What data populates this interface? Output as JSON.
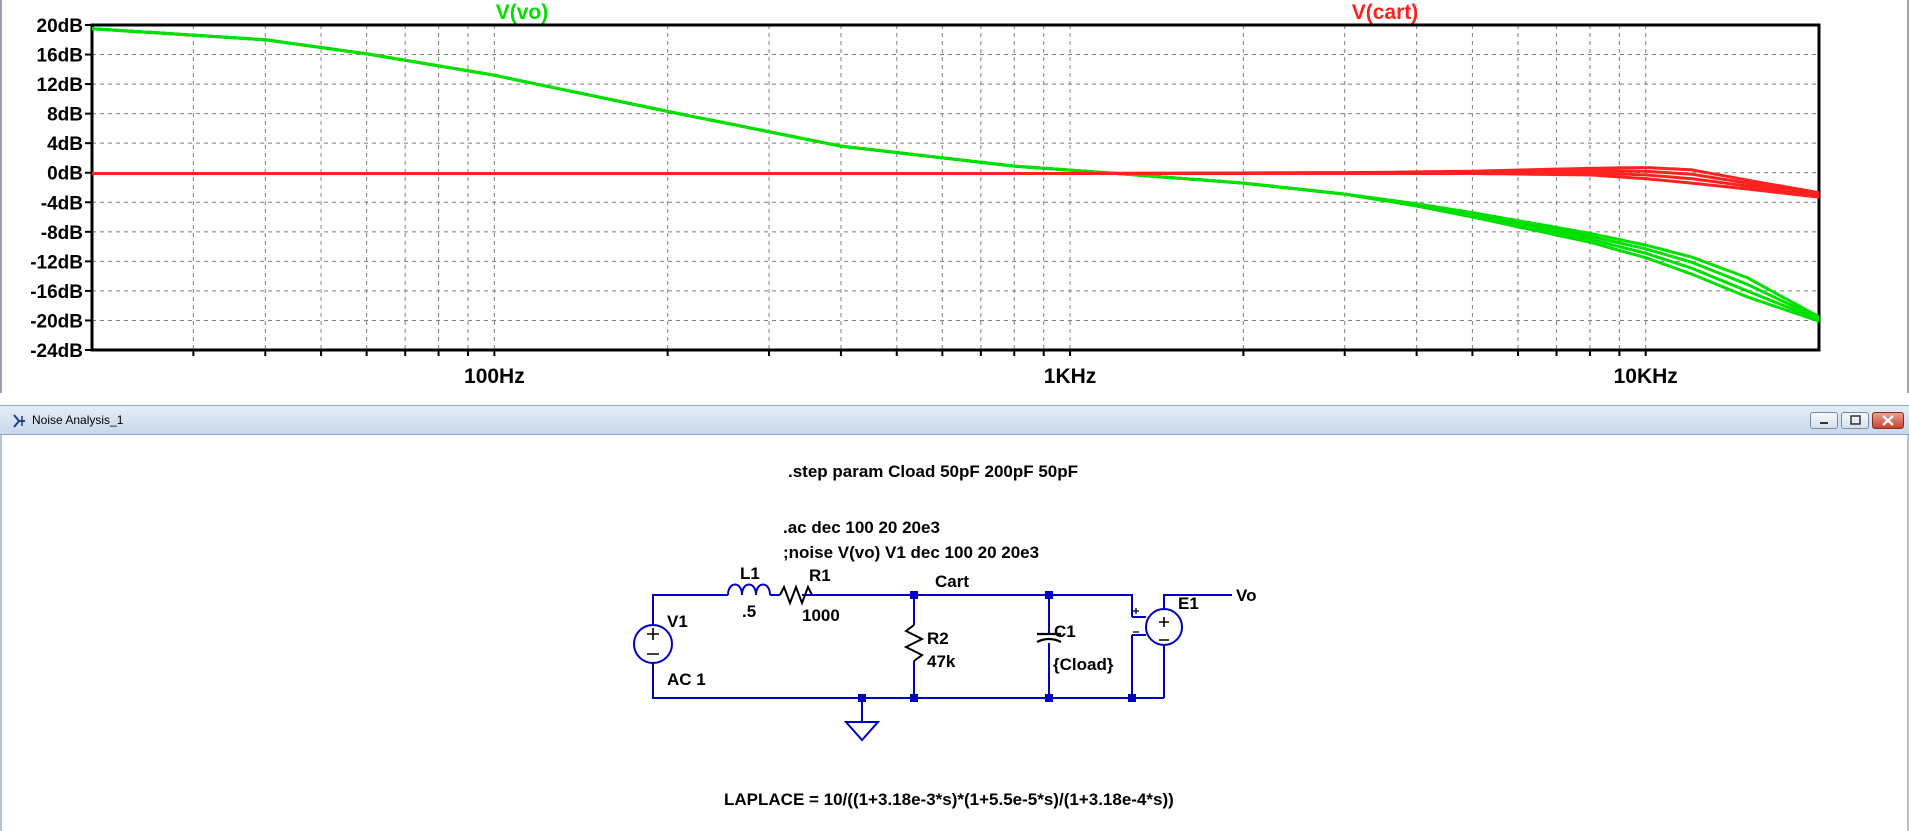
{
  "plot": {
    "chart_data": {
      "type": "line",
      "x_scale": "log",
      "xlim": [
        20,
        20000
      ],
      "ylim": [
        -24,
        20
      ],
      "y_ticks": [
        20,
        16,
        12,
        8,
        4,
        0,
        -4,
        -8,
        -12,
        -16,
        -20,
        -24
      ],
      "y_tick_labels": [
        "20dB",
        "16dB",
        "12dB",
        "8dB",
        "4dB",
        "0dB",
        "-4dB",
        "-8dB",
        "-12dB",
        "-16dB",
        "-20dB",
        "-24dB"
      ],
      "x_major_ticks": [
        100,
        1000,
        10000
      ],
      "x_tick_labels": [
        "100Hz",
        "1KHz",
        "10KHz"
      ],
      "grid": true,
      "series": [
        {
          "name": "V(vo)",
          "color": "#00e000",
          "curves": [
            {
              "x": [
                20,
                40,
                60,
                100,
                200,
                400,
                800,
                1300,
                2000,
                3000,
                4000,
                5000,
                8000,
                10000,
                12000,
                15000,
                20000
              ],
              "y": [
                19.5,
                18.0,
                16.1,
                13.2,
                8.3,
                3.6,
                0.9,
                -0.3,
                -1.4,
                -2.9,
                -4.2,
                -5.4,
                -8.2,
                -9.8,
                -11.4,
                -14.2,
                -19.5
              ]
            },
            {
              "x": [
                20,
                40,
                60,
                100,
                200,
                400,
                800,
                1300,
                2000,
                3000,
                4000,
                5000,
                8000,
                10000,
                12000,
                15000,
                20000
              ],
              "y": [
                19.5,
                18.0,
                16.1,
                13.2,
                8.3,
                3.6,
                0.9,
                -0.3,
                -1.4,
                -2.9,
                -4.3,
                -5.6,
                -8.6,
                -10.3,
                -12.1,
                -15.1,
                -19.7
              ]
            },
            {
              "x": [
                20,
                40,
                60,
                100,
                200,
                400,
                800,
                1300,
                2000,
                3000,
                4000,
                5000,
                8000,
                10000,
                12000,
                15000,
                20000
              ],
              "y": [
                19.5,
                18.0,
                16.1,
                13.2,
                8.3,
                3.6,
                0.9,
                -0.3,
                -1.4,
                -2.9,
                -4.4,
                -5.8,
                -9.0,
                -10.9,
                -12.9,
                -16.0,
                -19.9
              ]
            },
            {
              "x": [
                20,
                40,
                60,
                100,
                200,
                400,
                800,
                1300,
                2000,
                3000,
                4000,
                5000,
                8000,
                10000,
                12000,
                15000,
                20000
              ],
              "y": [
                19.5,
                18.0,
                16.1,
                13.2,
                8.3,
                3.6,
                0.9,
                -0.3,
                -1.4,
                -2.9,
                -4.5,
                -6.0,
                -9.4,
                -11.5,
                -13.7,
                -16.8,
                -20.1
              ]
            }
          ]
        },
        {
          "name": "V(cart)",
          "color": "#ff2020",
          "curves": [
            {
              "x": [
                20,
                1000,
                3000,
                5000,
                8000,
                10000,
                12000,
                15000,
                20000
              ],
              "y": [
                -0.1,
                -0.1,
                0.0,
                0.2,
                0.6,
                0.7,
                0.4,
                -1.0,
                -2.7
              ]
            },
            {
              "x": [
                20,
                1000,
                3000,
                5000,
                8000,
                10000,
                12000,
                15000,
                20000
              ],
              "y": [
                -0.1,
                -0.1,
                0.0,
                0.1,
                0.3,
                0.2,
                -0.2,
                -1.4,
                -2.9
              ]
            },
            {
              "x": [
                20,
                1000,
                3000,
                5000,
                8000,
                10000,
                12000,
                15000,
                20000
              ],
              "y": [
                -0.1,
                -0.1,
                -0.1,
                0.0,
                0.0,
                -0.3,
                -0.8,
                -1.8,
                -3.1
              ]
            },
            {
              "x": [
                20,
                1000,
                3000,
                5000,
                8000,
                10000,
                12000,
                15000,
                20000
              ],
              "y": [
                -0.1,
                -0.1,
                -0.1,
                -0.1,
                -0.3,
                -0.8,
                -1.4,
                -2.2,
                -3.3
              ]
            }
          ]
        }
      ]
    }
  },
  "window": {
    "title": "Noise Analysis_1"
  },
  "schematic": {
    "directive_step": ".step param Cload  50pF 200pF 50pF",
    "directive_ac": ".ac dec 100 20 20e3",
    "directive_noise": ";noise V(vo) V1 dec 100 20 20e3",
    "l1_name": "L1",
    "l1_value": ".5",
    "r1_name": "R1",
    "r1_value": "1000",
    "r2_name": "R2",
    "r2_value": "47k",
    "c1_name": "C1",
    "c1_value": "{Cload}",
    "v1_name": "V1",
    "v1_value": "AC 1",
    "e1_name": "E1",
    "net_cart": "Cart",
    "net_vo": "Vo",
    "laplace": "LAPLACE = 10/((1+3.18e-3*s)*(1+5.5e-5*s)/(1+3.18e-4*s))",
    "wire_color": "#0000c0"
  }
}
